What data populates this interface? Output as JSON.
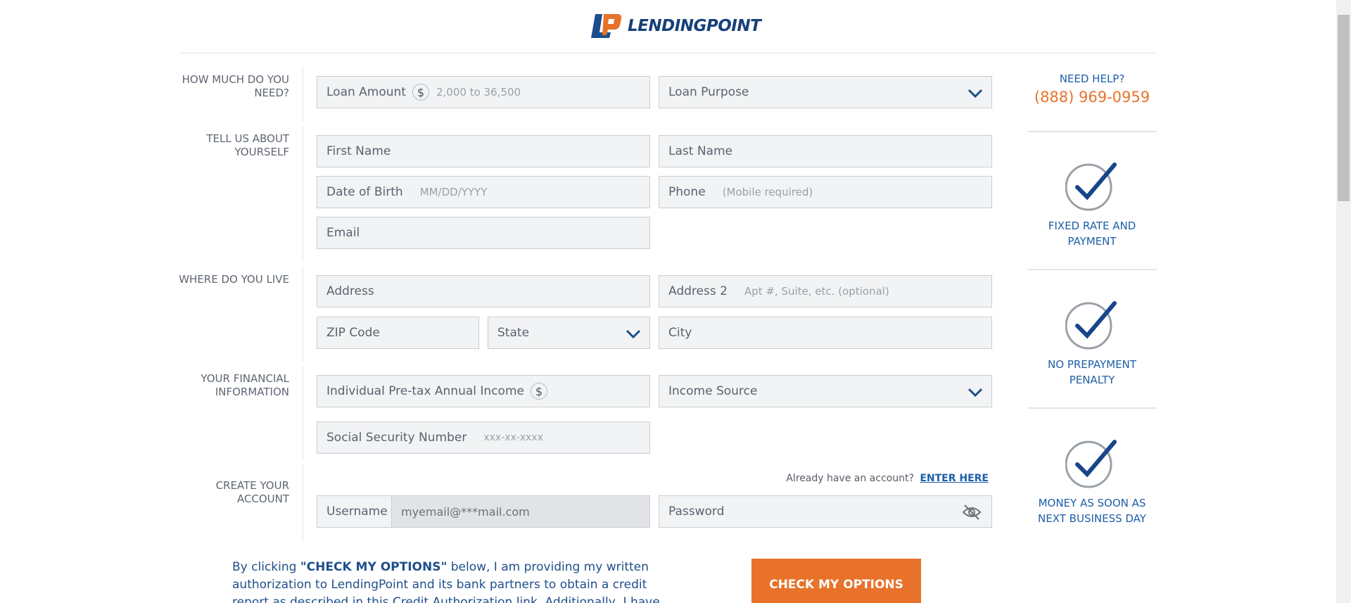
{
  "header": {
    "logo_word": "LENDINGPOINT"
  },
  "sections": {
    "amount": "HOW MUCH DO YOU NEED?",
    "about": "TELL US ABOUT YOURSELF",
    "live": "WHERE DO YOU LIVE",
    "financial": "YOUR FINANCIAL INFORMATION",
    "account": "CREATE YOUR ACCOUNT"
  },
  "fields": {
    "loan_amount": {
      "label": "Loan Amount",
      "placeholder": "2,000 to 36,500"
    },
    "loan_purpose": {
      "label": "Loan Purpose"
    },
    "first_name": {
      "label": "First Name"
    },
    "last_name": {
      "label": "Last Name"
    },
    "dob": {
      "label": "Date of Birth",
      "placeholder": "MM/DD/YYYY"
    },
    "phone": {
      "label": "Phone",
      "placeholder": "(Mobile required)"
    },
    "email": {
      "label": "Email"
    },
    "address": {
      "label": "Address"
    },
    "address2": {
      "label": "Address 2",
      "placeholder": "Apt #, Suite, etc. (optional)"
    },
    "zip": {
      "label": "ZIP Code"
    },
    "state": {
      "label": "State"
    },
    "city": {
      "label": "City"
    },
    "income": {
      "label": "Individual Pre-tax Annual Income"
    },
    "income_source": {
      "label": "Income Source"
    },
    "ssn": {
      "label": "Social Security Number",
      "placeholder": "xxx-xx-xxxx"
    },
    "username": {
      "label": "Username",
      "value": "myemail@***mail.com"
    },
    "password": {
      "label": "Password"
    }
  },
  "account_hint": {
    "text": "Already have an account?",
    "link": "ENTER HERE"
  },
  "sidebar": {
    "help_title": "NEED HELP?",
    "help_phone": "(888) 969-0959",
    "badges": [
      "FIXED RATE AND PAYMENT",
      "NO PREPAYMENT PENALTY",
      "MONEY AS SOON AS NEXT BUSINESS DAY"
    ]
  },
  "legal": {
    "pre": "By clicking ",
    "cta_ref": "\"CHECK MY OPTIONS\"",
    "post": " below, I am providing my written authorization to LendingPoint and its bank partners to obtain a credit report as described in this Credit Authorization link. Additionally, I have reviewed and agree to"
  },
  "cta": {
    "label": "CHECK MY OPTIONS"
  },
  "colors": {
    "brand_blue": "#1d5fa8",
    "brand_orange": "#e8722a",
    "field_bg": "#f2f3f4"
  },
  "icons": [
    "logo-icon",
    "dollar-icon",
    "chevron-down-icon",
    "eye-off-icon",
    "check-circle-icon"
  ]
}
